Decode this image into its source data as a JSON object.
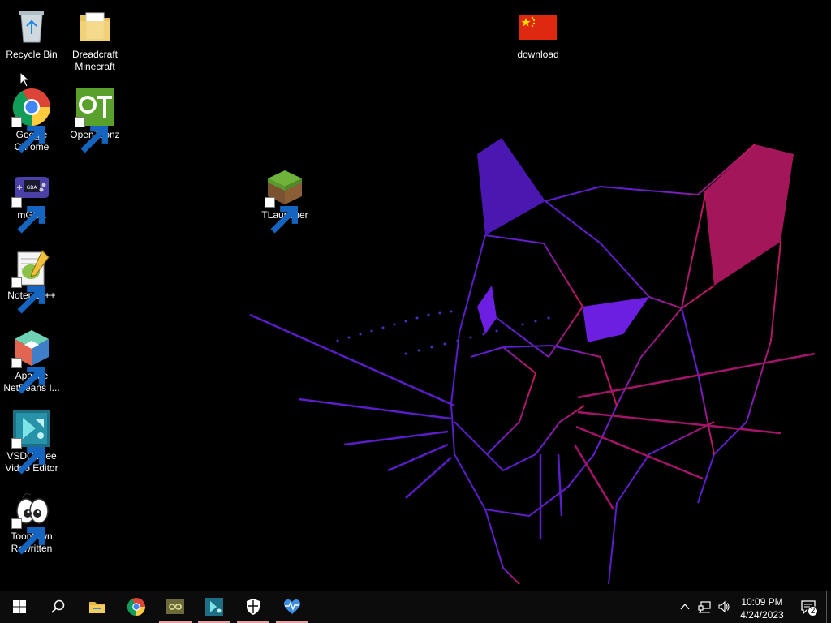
{
  "desktop": {
    "icons": [
      {
        "id": "recycle-bin",
        "label": "Recycle Bin",
        "icon": "recycle-bin-icon",
        "shortcut": false
      },
      {
        "id": "dreadcraft",
        "label": "Dreadcraft Minecraft",
        "icon": "folder-icon",
        "shortcut": false
      },
      {
        "id": "download",
        "label": "download",
        "icon": "china-flag-image-icon",
        "shortcut": false
      },
      {
        "id": "chrome",
        "label": "Google Chrome",
        "icon": "chrome-icon",
        "shortcut": true
      },
      {
        "id": "opentoonz",
        "label": "OpenToonz",
        "icon": "opentoonz-icon",
        "shortcut": true
      },
      {
        "id": "mgba",
        "label": "mGBA",
        "icon": "gameboy-advance-icon",
        "shortcut": true
      },
      {
        "id": "tlauncher",
        "label": "TLauncher",
        "icon": "grass-block-icon",
        "shortcut": true
      },
      {
        "id": "notepadpp",
        "label": "Notepad++",
        "icon": "notepad-plus-plus-icon",
        "shortcut": true
      },
      {
        "id": "netbeans",
        "label": "Apache NetBeans I...",
        "icon": "netbeans-cube-icon",
        "shortcut": true
      },
      {
        "id": "vsdc",
        "label": "VSDC Free Video Editor",
        "icon": "vsdc-icon",
        "shortcut": true
      },
      {
        "id": "toontown",
        "label": "Toontown Rewritten",
        "icon": "toontown-icon",
        "shortcut": true
      }
    ]
  },
  "taskbar": {
    "pinned": [
      {
        "id": "start",
        "icon": "windows-start-icon",
        "running": false
      },
      {
        "id": "search",
        "icon": "search-icon",
        "running": false
      },
      {
        "id": "explorer",
        "icon": "file-explorer-icon",
        "running": false
      },
      {
        "id": "chrome",
        "icon": "chrome-icon",
        "running": false
      },
      {
        "id": "app-green",
        "icon": "infinity-app-icon",
        "running": true
      },
      {
        "id": "vsdc",
        "icon": "vsdc-icon",
        "running": true
      },
      {
        "id": "security",
        "icon": "windows-security-icon",
        "running": true
      },
      {
        "id": "health",
        "icon": "heartbeat-icon",
        "running": true
      }
    ],
    "tray": {
      "time": "10:09 PM",
      "date": "4/24/2023",
      "notification_count": "2"
    }
  },
  "colors": {
    "taskbar_bg": "#0c0c0c",
    "running_indicator": "#e3a1a1",
    "wallpaper_purple": "#6a1fd1",
    "wallpaper_magenta": "#c2185b"
  }
}
